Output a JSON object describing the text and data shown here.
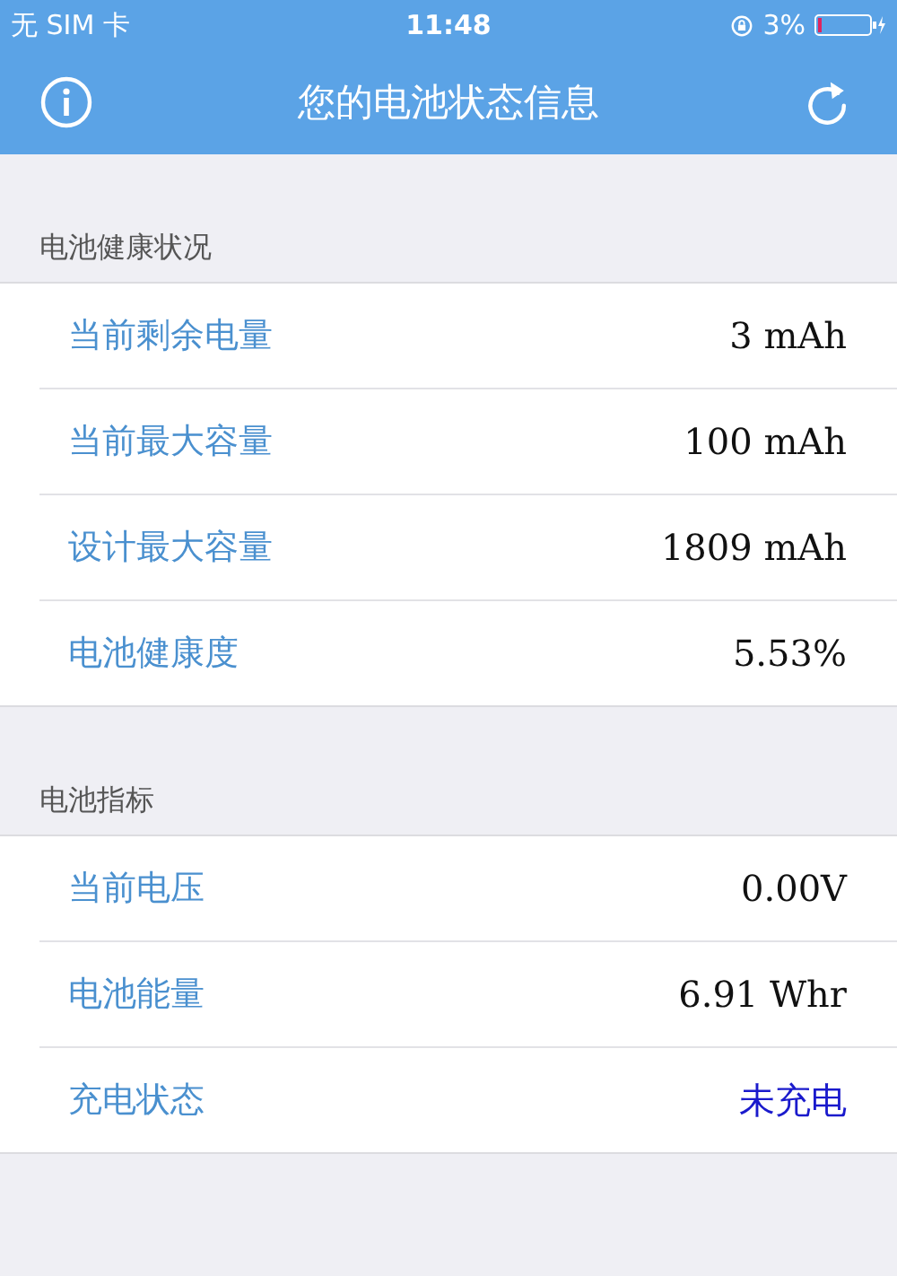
{
  "status_bar": {
    "carrier": "无 SIM 卡",
    "time": "11:48",
    "battery_percent": "3%"
  },
  "nav_bar": {
    "title": "您的电池状态信息"
  },
  "sections": [
    {
      "header": "电池健康状况",
      "rows": [
        {
          "label": "当前剩余电量",
          "value": "3 mAh",
          "kind": "value"
        },
        {
          "label": "当前最大容量",
          "value": "100 mAh",
          "kind": "value"
        },
        {
          "label": "设计最大容量",
          "value": "1809 mAh",
          "kind": "value"
        },
        {
          "label": "电池健康度",
          "value": "5.53%",
          "kind": "value"
        }
      ]
    },
    {
      "header": "电池指标",
      "rows": [
        {
          "label": "当前电压",
          "value": "0.00V",
          "kind": "value"
        },
        {
          "label": "电池能量",
          "value": "6.91 Whr",
          "kind": "value"
        },
        {
          "label": "充电状态",
          "value": "未充电",
          "kind": "status"
        }
      ]
    }
  ]
}
